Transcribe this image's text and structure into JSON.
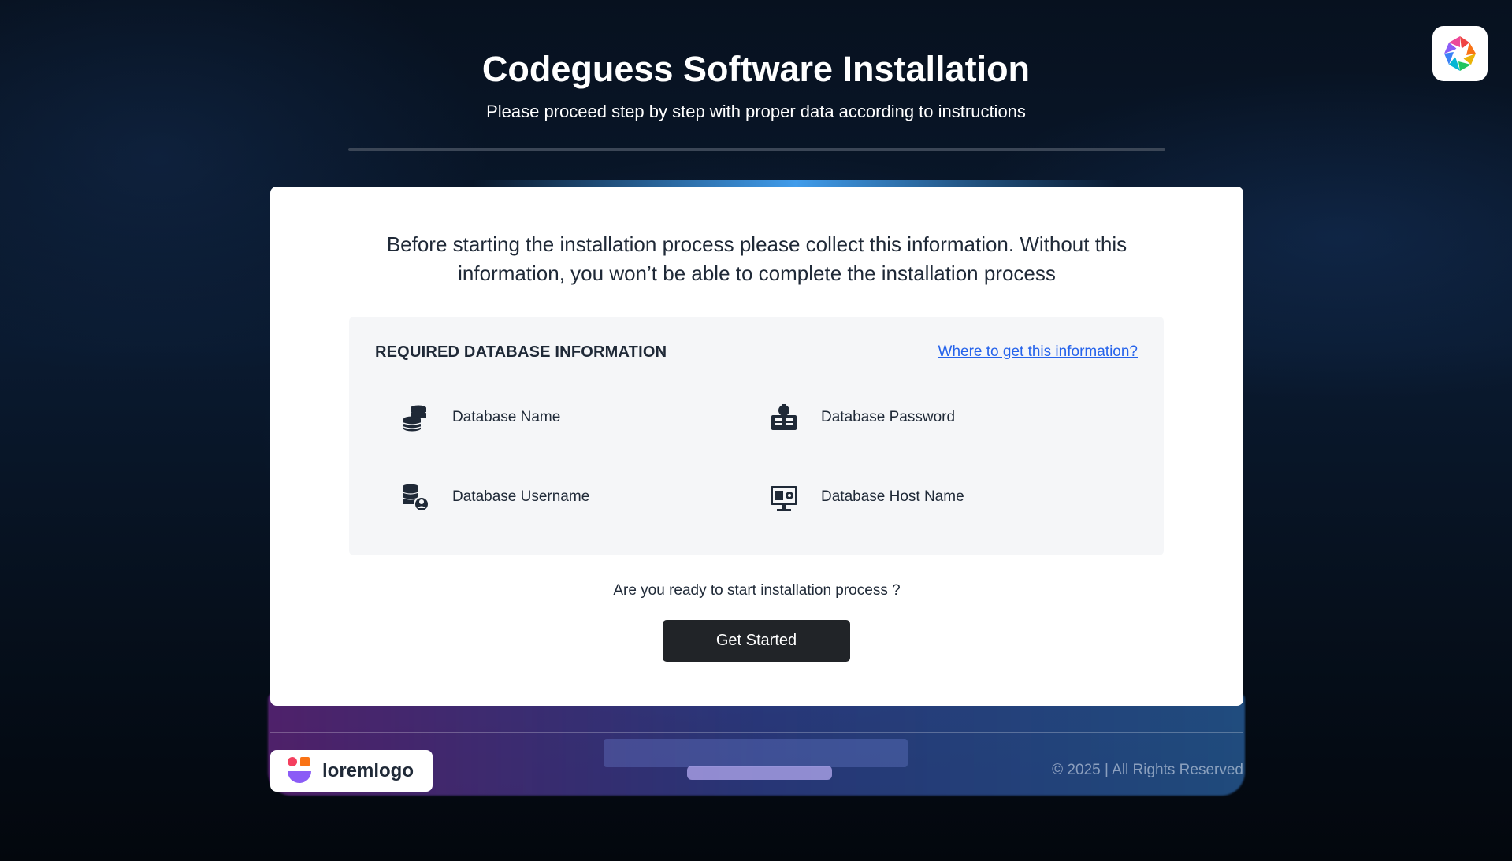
{
  "header": {
    "title": "Codeguess Software Installation",
    "subtitle": "Please proceed step by step with proper data according to instructions"
  },
  "card": {
    "intro": "Before starting the installation process please collect this information. Without this information, you won’t be able to complete the installation process",
    "info_box": {
      "heading": "REQUIRED DATABASE INFORMATION",
      "link": "Where to get this information?",
      "items": [
        {
          "label": "Database Name",
          "icon": "database-stack-icon"
        },
        {
          "label": "Database Password",
          "icon": "database-lock-icon"
        },
        {
          "label": "Database Username",
          "icon": "database-user-icon"
        },
        {
          "label": "Database Host Name",
          "icon": "database-host-icon"
        }
      ]
    },
    "ready_text": "Are you ready to start installation process ?",
    "button_label": "Get Started"
  },
  "footer": {
    "brand": "loremlogo",
    "copyright": "© 2025 | All Rights Reserved"
  },
  "colors": {
    "link": "#2563eb",
    "button": "#212428",
    "brand_pink": "#f43f5e",
    "brand_orange": "#f97316",
    "brand_purple": "#8b5cf6"
  }
}
